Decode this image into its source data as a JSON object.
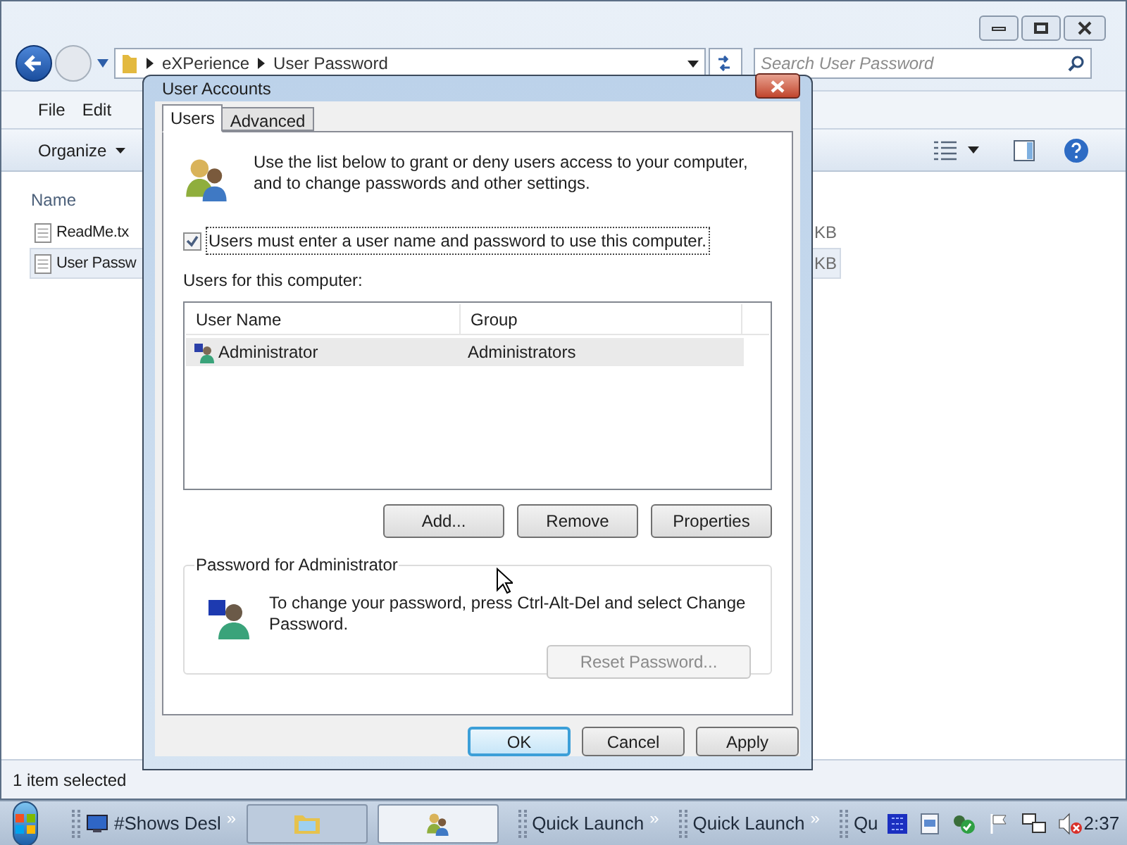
{
  "explorer": {
    "crumbs": [
      "eXPerience",
      "User Password"
    ],
    "search": {
      "placeholder": "Search User Password"
    },
    "menu": [
      "File",
      "Edit"
    ],
    "organize": "Organize",
    "columns": [
      "Name"
    ],
    "files": [
      {
        "name": "ReadMe.tx",
        "size": "KB",
        "selected": false
      },
      {
        "name": "User Passw",
        "size": "KB",
        "selected": true
      }
    ],
    "status": "1 item selected"
  },
  "dialog": {
    "title": "User Accounts",
    "tabs": [
      {
        "label": "Users",
        "selected": true
      },
      {
        "label": "Advanced",
        "selected": false
      }
    ],
    "intro": "Use the list below to grant or deny users access to your computer, and to change passwords and other settings.",
    "checkbox": {
      "label": "Users must enter a user name and password to use this computer.",
      "checked": true
    },
    "users_label": "Users for this computer:",
    "table": {
      "columns": [
        "User Name",
        "Group"
      ],
      "rows": [
        {
          "cells": [
            "Administrator",
            "Administrators"
          ],
          "selected": true
        }
      ]
    },
    "list_buttons": [
      "Add...",
      "Remove",
      "Properties"
    ],
    "password": {
      "title": "Password for Administrator",
      "text": "To change your password, press Ctrl-Alt-Del and select Change Password.",
      "button": {
        "label": "Reset Password...",
        "disabled": true
      }
    },
    "buttons": [
      {
        "label": "OK",
        "default": true
      },
      {
        "label": "Cancel",
        "default": false
      },
      {
        "label": "Apply",
        "default": false
      }
    ]
  },
  "taskbar": {
    "items": [
      {
        "kind": "toolbar",
        "label": "#Shows Desl"
      },
      {
        "kind": "chevron",
        "label": "»"
      },
      {
        "kind": "task",
        "active": false
      },
      {
        "kind": "task",
        "active": true
      },
      {
        "kind": "toolbar",
        "label": "Quick Launch"
      },
      {
        "kind": "chevron",
        "label": "»"
      },
      {
        "kind": "toolbar",
        "label": "Quick Launch"
      },
      {
        "kind": "chevron",
        "label": "»"
      },
      {
        "kind": "toolbar",
        "label": "Qu"
      }
    ],
    "clock": "2:37"
  }
}
